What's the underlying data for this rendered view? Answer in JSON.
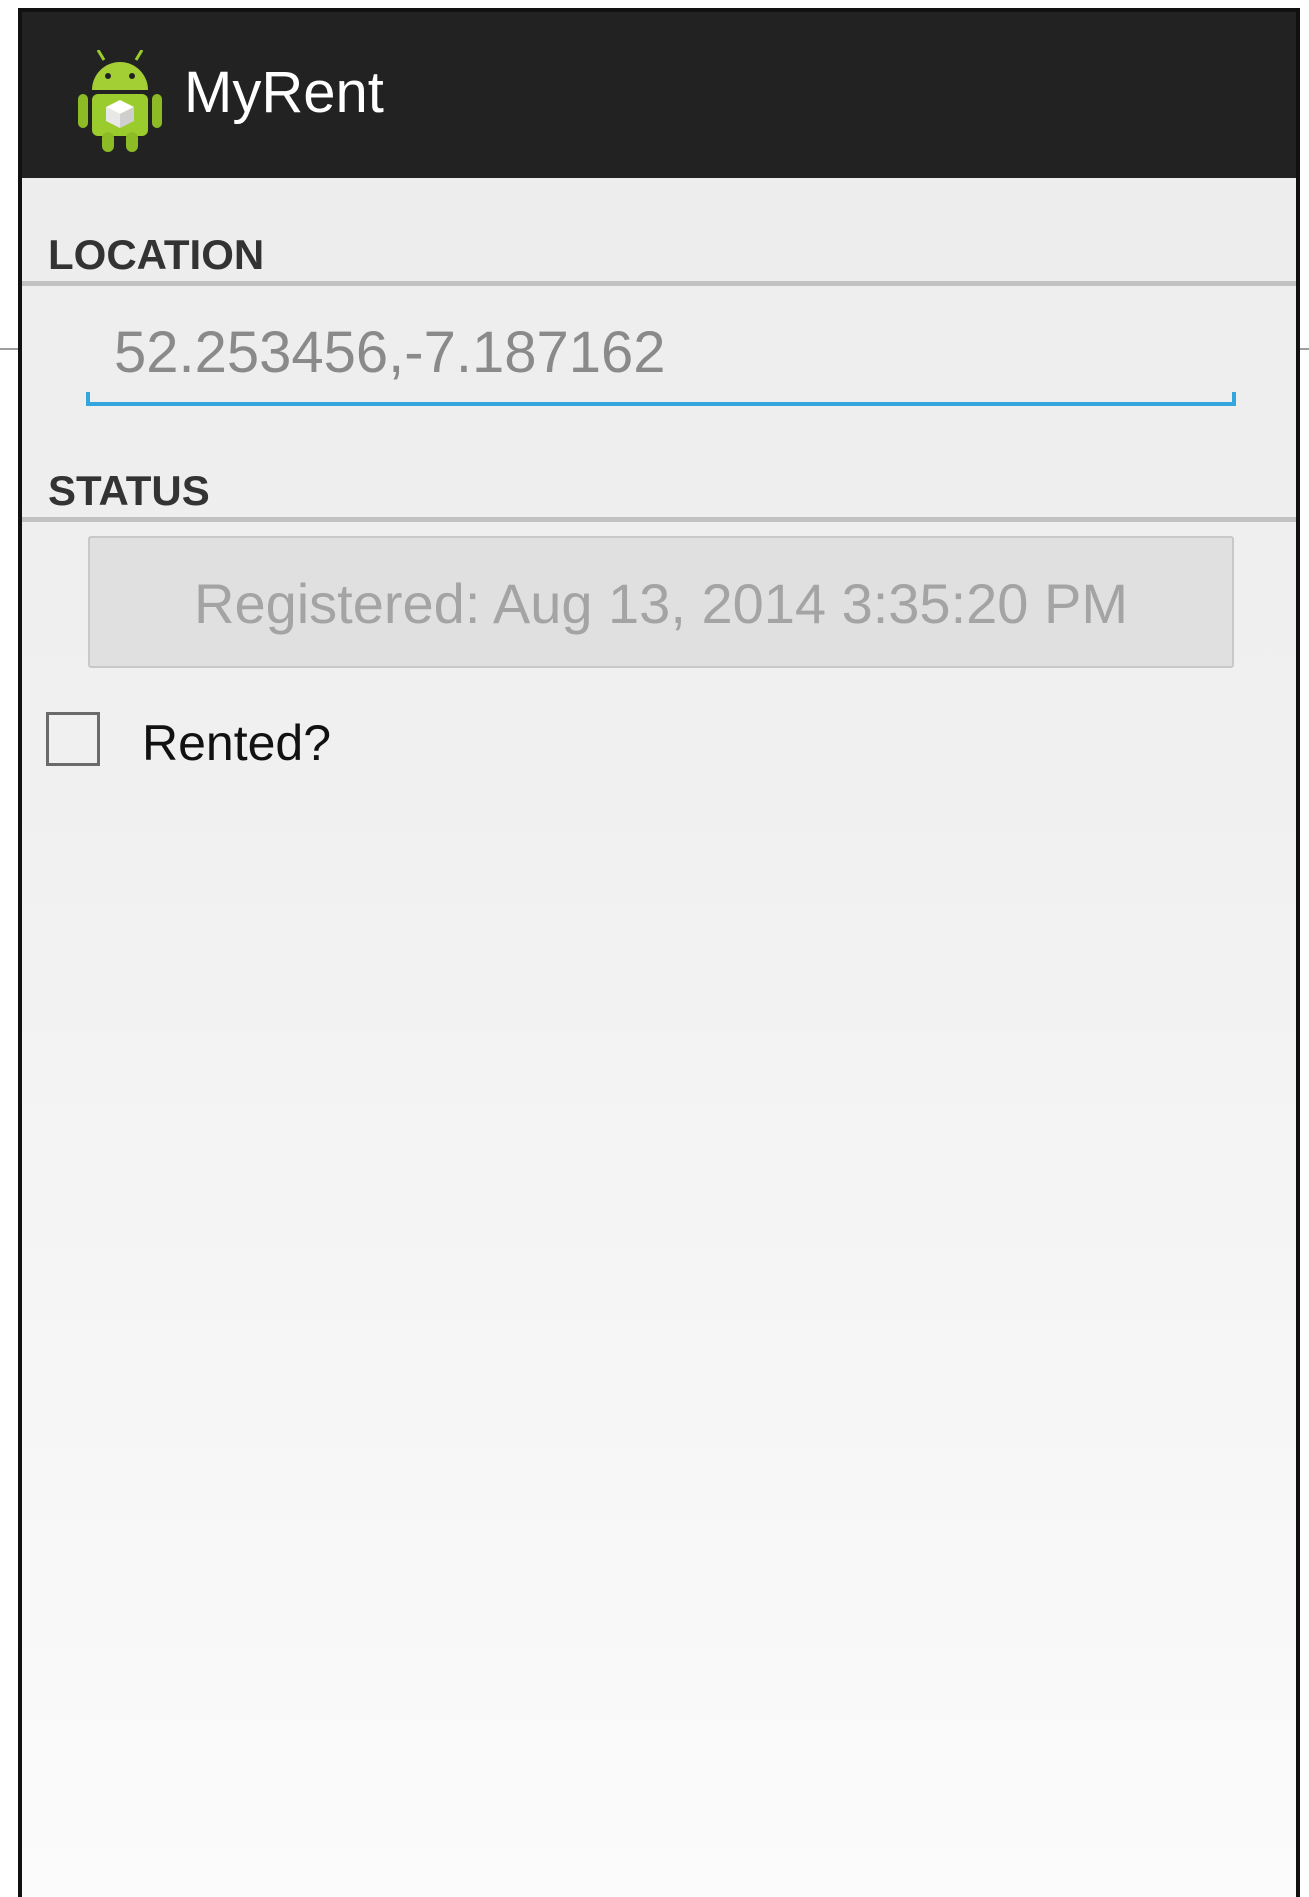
{
  "app": {
    "title": "MyRent",
    "icon": "android-robot-icon",
    "icon_color": "#9bcc2e",
    "action_bar_color": "#222222"
  },
  "location": {
    "header": "LOCATION",
    "value": "52.253456,-7.187162",
    "accent_color": "#33a6dd"
  },
  "status": {
    "header": "STATUS",
    "date_button": "Registered: Aug 13, 2014 3:35:20 PM",
    "rented_label": "Rented?",
    "rented_checked": false
  }
}
